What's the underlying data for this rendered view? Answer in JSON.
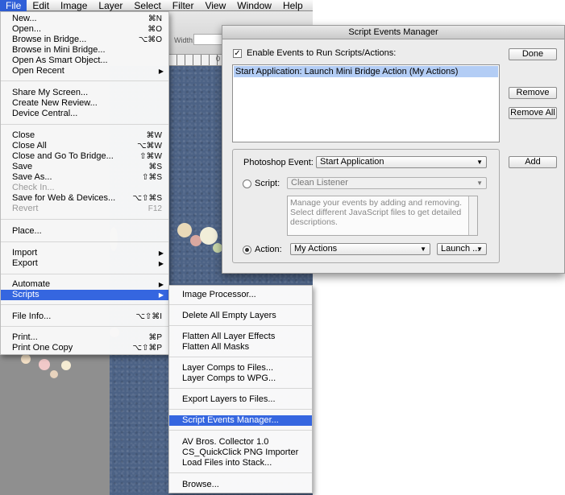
{
  "menubar": {
    "items": [
      "File",
      "Edit",
      "Image",
      "Layer",
      "Select",
      "Filter",
      "View",
      "Window",
      "Help"
    ]
  },
  "toolbar": {
    "width_label": "Width:"
  },
  "ruler": {
    "label": "0"
  },
  "file_menu": {
    "items": [
      {
        "label": "New...",
        "shortcut": "⌘N"
      },
      {
        "label": "Open...",
        "shortcut": "⌘O"
      },
      {
        "label": "Browse in Bridge...",
        "shortcut": "⌥⌘O"
      },
      {
        "label": "Browse in Mini Bridge...",
        "shortcut": ""
      },
      {
        "label": "Open As Smart Object...",
        "shortcut": ""
      },
      {
        "label": "Open Recent",
        "shortcut": ""
      },
      {
        "label": "Share My Screen...",
        "shortcut": ""
      },
      {
        "label": "Create New Review...",
        "shortcut": ""
      },
      {
        "label": "Device Central...",
        "shortcut": ""
      },
      {
        "label": "Close",
        "shortcut": "⌘W"
      },
      {
        "label": "Close All",
        "shortcut": "⌥⌘W"
      },
      {
        "label": "Close and Go To Bridge...",
        "shortcut": "⇧⌘W"
      },
      {
        "label": "Save",
        "shortcut": "⌘S"
      },
      {
        "label": "Save As...",
        "shortcut": "⇧⌘S"
      },
      {
        "label": "Check In...",
        "shortcut": ""
      },
      {
        "label": "Save for Web & Devices...",
        "shortcut": "⌥⇧⌘S"
      },
      {
        "label": "Revert",
        "shortcut": "F12"
      },
      {
        "label": "Place...",
        "shortcut": ""
      },
      {
        "label": "Import",
        "shortcut": ""
      },
      {
        "label": "Export",
        "shortcut": ""
      },
      {
        "label": "Automate",
        "shortcut": ""
      },
      {
        "label": "Scripts",
        "shortcut": ""
      },
      {
        "label": "File Info...",
        "shortcut": "⌥⇧⌘I"
      },
      {
        "label": "Print...",
        "shortcut": "⌘P"
      },
      {
        "label": "Print One Copy",
        "shortcut": "⌥⇧⌘P"
      }
    ]
  },
  "scripts_menu": {
    "items": [
      "Image Processor...",
      "Delete All Empty Layers",
      "Flatten All Layer Effects",
      "Flatten All Masks",
      "Layer Comps to Files...",
      "Layer Comps to WPG...",
      "Export Layers to Files...",
      "Script Events Manager...",
      "AV Bros. Collector 1.0",
      "CS_QuickClick PNG Importer",
      "Load Files into Stack...",
      "Browse..."
    ]
  },
  "dialog": {
    "title": "Script Events Manager",
    "enable_label": "Enable Events to Run Scripts/Actions:",
    "enable_checked": "✓",
    "event_row": "Start Application: Launch Mini Bridge Action (My Actions)",
    "done_label": "Done",
    "remove_label": "Remove",
    "remove_all_label": "Remove All",
    "add_label": "Add",
    "photoshop_event_label": "Photoshop Event:",
    "photoshop_event_value": "Start Application",
    "script_label": "Script:",
    "script_value": "Clean Listener",
    "description": "Manage your events by adding and removing. Select different JavaScript files to get detailed descriptions.",
    "action_label": "Action:",
    "action_set_value": "My Actions",
    "action_value": "Launch ...",
    "arrow_glyph": "▼"
  }
}
